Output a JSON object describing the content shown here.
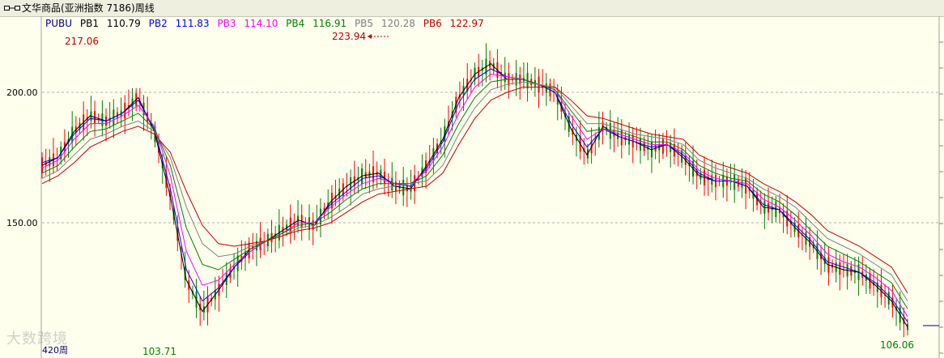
{
  "window": {
    "title": "文华商品(亚洲指数 7186)周线"
  },
  "legend": [
    {
      "name": "PUBU",
      "value": "",
      "color": "#000080"
    },
    {
      "name": "PB1",
      "value": "110.79",
      "color": "#000000"
    },
    {
      "name": "PB2",
      "value": "111.83",
      "color": "#0000ff"
    },
    {
      "name": "PB3",
      "value": "114.10",
      "color": "#ff00ff"
    },
    {
      "name": "PB4",
      "value": "116.91",
      "color": "#008000"
    },
    {
      "name": "PB5",
      "value": "120.28",
      "color": "#808080"
    },
    {
      "name": "PB6",
      "value": "122.97",
      "color": "#c00000"
    }
  ],
  "period_label": "420周",
  "watermark_text": "大数跨境",
  "colors": {
    "up": "#ff0000",
    "down": "#008000",
    "background": "#ffffee",
    "grid": "#b0b0b0"
  },
  "chart_data": {
    "type": "line",
    "title": "",
    "xlabel": "",
    "ylabel": "",
    "ylim": [
      100,
      228
    ],
    "y_ticks": [
      "200.00",
      "150.00"
    ],
    "annotations": [
      {
        "label": "217.06",
        "value": 217.06,
        "kind": "local_high"
      },
      {
        "label": "223.94",
        "value": 223.94,
        "kind": "global_high"
      },
      {
        "label": "103.71",
        "value": 103.71,
        "kind": "global_low"
      },
      {
        "label": "106.06",
        "value": 106.06,
        "kind": "last"
      }
    ],
    "x_index": [
      0,
      5,
      10,
      15,
      20,
      25,
      30,
      35,
      40,
      45,
      50,
      55,
      60,
      65,
      70,
      75,
      80,
      85,
      90,
      95,
      100,
      105,
      110,
      115,
      120,
      125,
      130,
      135,
      140,
      145,
      150,
      155,
      160,
      165,
      170,
      175,
      180,
      185,
      190,
      195,
      200,
      205,
      210,
      215,
      220,
      225,
      230,
      235
    ],
    "series": [
      {
        "name": "PB1",
        "color": "#000000",
        "values": [
          172,
          175,
          185,
          191,
          189,
          192,
          198,
          185,
          160,
          128,
          116,
          124,
          133,
          140,
          143,
          147,
          151,
          149,
          158,
          164,
          168,
          169,
          164,
          163,
          172,
          182,
          198,
          207,
          211,
          205,
          205,
          203,
          200,
          186,
          176,
          187,
          183,
          181,
          178,
          180,
          175,
          168,
          166,
          166,
          164,
          156,
          155,
          148,
          142,
          134,
          132,
          131,
          126,
          120,
          110
        ]
      },
      {
        "name": "PB2",
        "color": "#0000ff",
        "values": [
          173,
          175,
          184,
          190,
          189,
          192,
          197,
          186,
          163,
          132,
          120,
          125,
          133,
          139,
          143,
          146,
          150,
          150,
          157,
          162,
          167,
          168,
          165,
          164,
          171,
          181,
          196,
          205,
          209,
          206,
          205,
          203,
          200,
          188,
          179,
          186,
          183,
          181,
          179,
          180,
          176,
          169,
          166,
          166,
          164,
          157,
          155,
          149,
          143,
          135,
          133,
          131,
          127,
          121,
          112
        ]
      },
      {
        "name": "PB3",
        "color": "#ff00ff",
        "values": [
          171,
          174,
          182,
          188,
          188,
          191,
          195,
          187,
          168,
          139,
          126,
          128,
          134,
          139,
          143,
          146,
          150,
          150,
          156,
          161,
          165,
          167,
          165,
          165,
          170,
          179,
          192,
          202,
          207,
          206,
          205,
          203,
          201,
          191,
          182,
          186,
          184,
          182,
          180,
          180,
          177,
          170,
          167,
          166,
          165,
          159,
          156,
          151,
          145,
          138,
          135,
          133,
          129,
          124,
          114
        ]
      },
      {
        "name": "PB4",
        "color": "#008000",
        "values": [
          169,
          172,
          179,
          185,
          186,
          189,
          192,
          186,
          172,
          148,
          134,
          132,
          136,
          140,
          143,
          146,
          149,
          150,
          154,
          159,
          163,
          165,
          165,
          165,
          168,
          176,
          188,
          198,
          204,
          205,
          205,
          203,
          201,
          193,
          185,
          186,
          185,
          183,
          181,
          181,
          178,
          172,
          169,
          167,
          166,
          161,
          158,
          153,
          147,
          141,
          138,
          135,
          131,
          127,
          117
        ]
      },
      {
        "name": "PB5",
        "color": "#808080",
        "values": [
          167,
          170,
          176,
          182,
          184,
          187,
          189,
          185,
          175,
          156,
          142,
          137,
          138,
          141,
          143,
          145,
          148,
          149,
          152,
          156,
          161,
          163,
          164,
          165,
          166,
          172,
          184,
          194,
          201,
          203,
          204,
          203,
          202,
          195,
          188,
          188,
          186,
          184,
          183,
          182,
          180,
          174,
          171,
          169,
          167,
          163,
          160,
          156,
          150,
          144,
          141,
          138,
          134,
          130,
          120
        ]
      },
      {
        "name": "PB6",
        "color": "#c00000",
        "values": [
          165,
          168,
          173,
          179,
          182,
          185,
          187,
          184,
          177,
          162,
          149,
          142,
          141,
          142,
          143,
          145,
          147,
          148,
          150,
          154,
          158,
          161,
          162,
          163,
          164,
          169,
          180,
          190,
          197,
          200,
          202,
          202,
          202,
          197,
          191,
          190,
          188,
          186,
          184,
          183,
          182,
          176,
          173,
          171,
          169,
          165,
          162,
          158,
          153,
          147,
          144,
          141,
          137,
          133,
          123
        ]
      }
    ]
  }
}
